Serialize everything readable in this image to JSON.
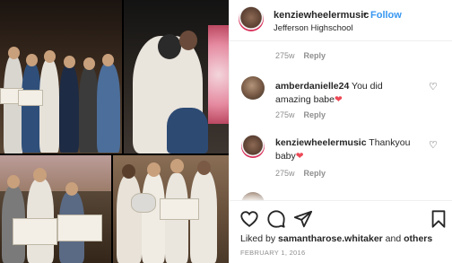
{
  "post": {
    "author": "kenziewheelermusic",
    "separator": "•",
    "follow_label": "Follow",
    "location": "Jefferson Highschool"
  },
  "comments": [
    {
      "username": "",
      "text": "",
      "time": "275w",
      "reply_label": "Reply"
    },
    {
      "username": "amberdanielle24",
      "text": "You did amazing babe",
      "emoji": "heart",
      "time": "275w",
      "reply_label": "Reply"
    },
    {
      "username": "kenziewheelermusic",
      "text": "Thankyou baby",
      "emoji": "heart",
      "time": "275w",
      "reply_label": "Reply"
    }
  ],
  "actions": {
    "like": "heart-outline-icon",
    "comment": "comment-bubble-icon",
    "share": "paper-plane-icon",
    "save": "bookmark-icon"
  },
  "likes": {
    "prefix": "Liked by",
    "user": "samantharose.whitaker",
    "connector": "and",
    "others": "others"
  },
  "date": "FEBRUARY 1, 2016",
  "colors": {
    "link_blue": "#3897f0",
    "heart_red": "#ed4956",
    "muted_gray": "#8e8e8e",
    "text_dark": "#262626"
  }
}
